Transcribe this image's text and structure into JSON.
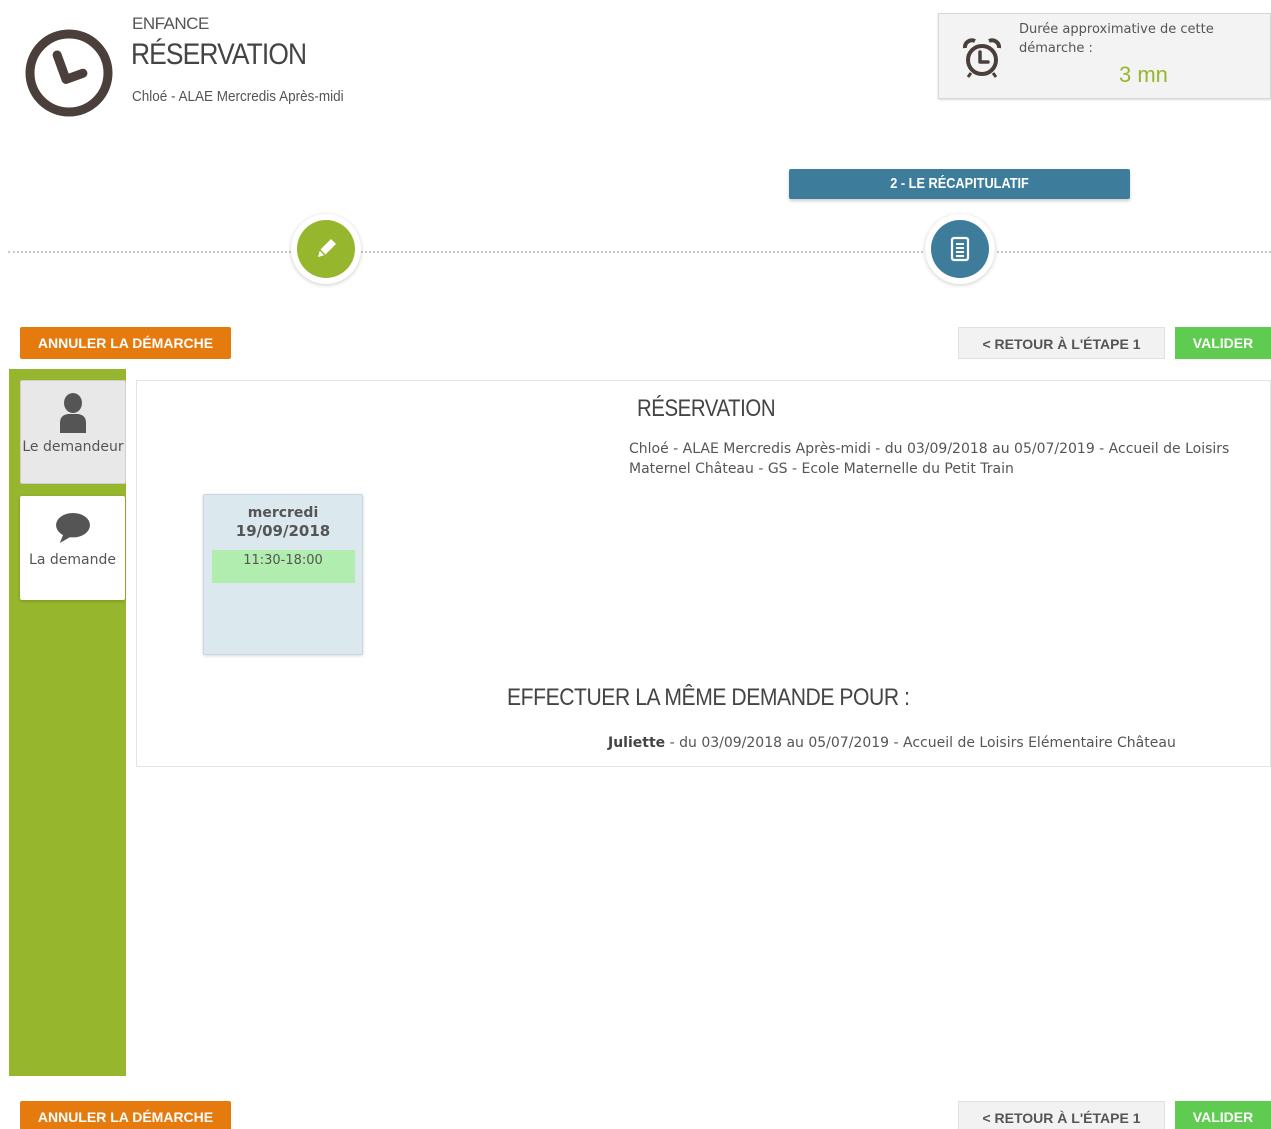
{
  "header": {
    "category": "ENFANCE",
    "title": "RÉSERVATION",
    "subtitle": "Chloé - ALAE Mercredis Après-midi",
    "icon": "clock-icon"
  },
  "duration": {
    "label": "Durée approximative de cette démarche :",
    "value": "3 mn",
    "icon": "alarm-clock-icon",
    "value_color": "#96b62e"
  },
  "stepper": {
    "current_step_label": "2 - LE RÉCAPITULATIF",
    "steps": [
      {
        "icon": "pencil-icon",
        "color": "#96b62e"
      },
      {
        "icon": "document-icon",
        "color": "#3d7d9b"
      }
    ]
  },
  "actions": {
    "cancel_label": "ANNULER LA DÉMARCHE",
    "back_label": "< RETOUR À L'ÉTAPE 1",
    "validate_label": "VALIDER"
  },
  "sidebar": {
    "items": [
      {
        "label": "Le demandeur",
        "icon": "person-icon"
      },
      {
        "label": "La demande",
        "icon": "speech-bubble-icon"
      }
    ]
  },
  "summary": {
    "title": "RÉSERVATION",
    "description": "Chloé - ALAE Mercredis Après-midi - du 03/09/2018 au 05/07/2019 - Accueil de Loisirs Maternel Château - GS - Ecole Maternelle du Petit Train",
    "day": {
      "weekday": "mercredi",
      "date": "19/09/2018",
      "slot": "11:30-18:00"
    },
    "same_request_title": "EFFECTUER LA MÊME DEMANDE POUR :",
    "same_request_name": "Juliette",
    "same_request_details": " - du 03/09/2018 au 05/07/2019 - Accueil de Loisirs Elémentaire Château"
  },
  "colors": {
    "accent_green": "#96b62e",
    "accent_blue": "#3d7d9b",
    "cancel_orange": "#e57b0e",
    "validate_green": "#5fcb50"
  }
}
